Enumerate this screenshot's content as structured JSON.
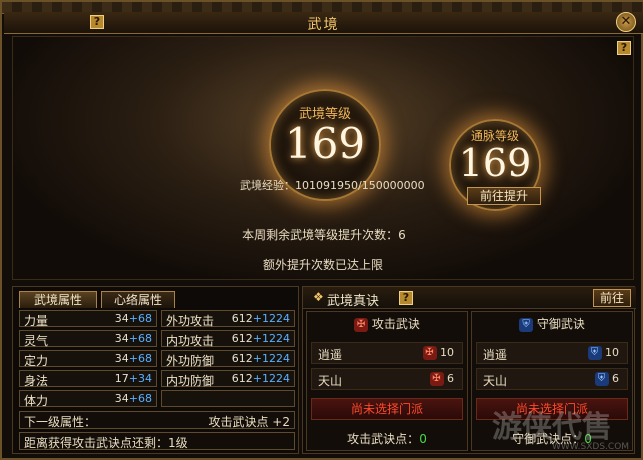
{
  "window": {
    "title": "武境",
    "help": "?",
    "close": "✕"
  },
  "level": {
    "label": "武境等级",
    "value": "169"
  },
  "meridian": {
    "label": "通脉等级",
    "value": "169"
  },
  "experience": {
    "label": "武境经验：",
    "value": "101091950/150000000"
  },
  "goto_upgrade": "前往提升",
  "weekly_remaining": "本周剩余武境等级提升次数：6",
  "extra_limit": "额外提升次数已达上限",
  "attr_tabs": [
    "武境属性",
    "心络属性"
  ],
  "attrs_left": [
    {
      "name": "力量",
      "base": "34",
      "bonus": "+68"
    },
    {
      "name": "灵气",
      "base": "34",
      "bonus": "+68"
    },
    {
      "name": "定力",
      "base": "34",
      "bonus": "+68"
    },
    {
      "name": "身法",
      "base": "17",
      "bonus": "+34"
    },
    {
      "name": "体力",
      "base": "34",
      "bonus": "+68"
    }
  ],
  "attrs_right": [
    {
      "name": "外功攻击",
      "base": "612",
      "bonus": "+1224"
    },
    {
      "name": "内功攻击",
      "base": "612",
      "bonus": "+1224"
    },
    {
      "name": "外功防御",
      "base": "612",
      "bonus": "+1224"
    },
    {
      "name": "内功防御",
      "base": "612",
      "bonus": "+1224"
    },
    {
      "name": "",
      "base": "",
      "bonus": ""
    }
  ],
  "next_level": {
    "label": "下一级属性：",
    "value": "攻击武诀点 +2"
  },
  "next_point": "距离获得攻击武诀点还剩：1级",
  "secrets": {
    "title": "武境真诀",
    "help": "?",
    "goto": "前往",
    "attack": {
      "title": "攻击武诀",
      "rows": [
        {
          "name": "逍遥",
          "level": "10"
        },
        {
          "name": "天山",
          "level": "6"
        }
      ],
      "warning": "尚未选择门派",
      "points_label": "攻击武诀点：",
      "points": "0"
    },
    "defense": {
      "title": "守御武诀",
      "rows": [
        {
          "name": "逍遥",
          "level": "10"
        },
        {
          "name": "天山",
          "level": "6"
        }
      ],
      "warning": "尚未选择门派",
      "points_label": "守御武诀点：",
      "points": "0"
    }
  },
  "watermark": {
    "text": "游侠代售",
    "site": "WWW.SXDS.COM"
  }
}
